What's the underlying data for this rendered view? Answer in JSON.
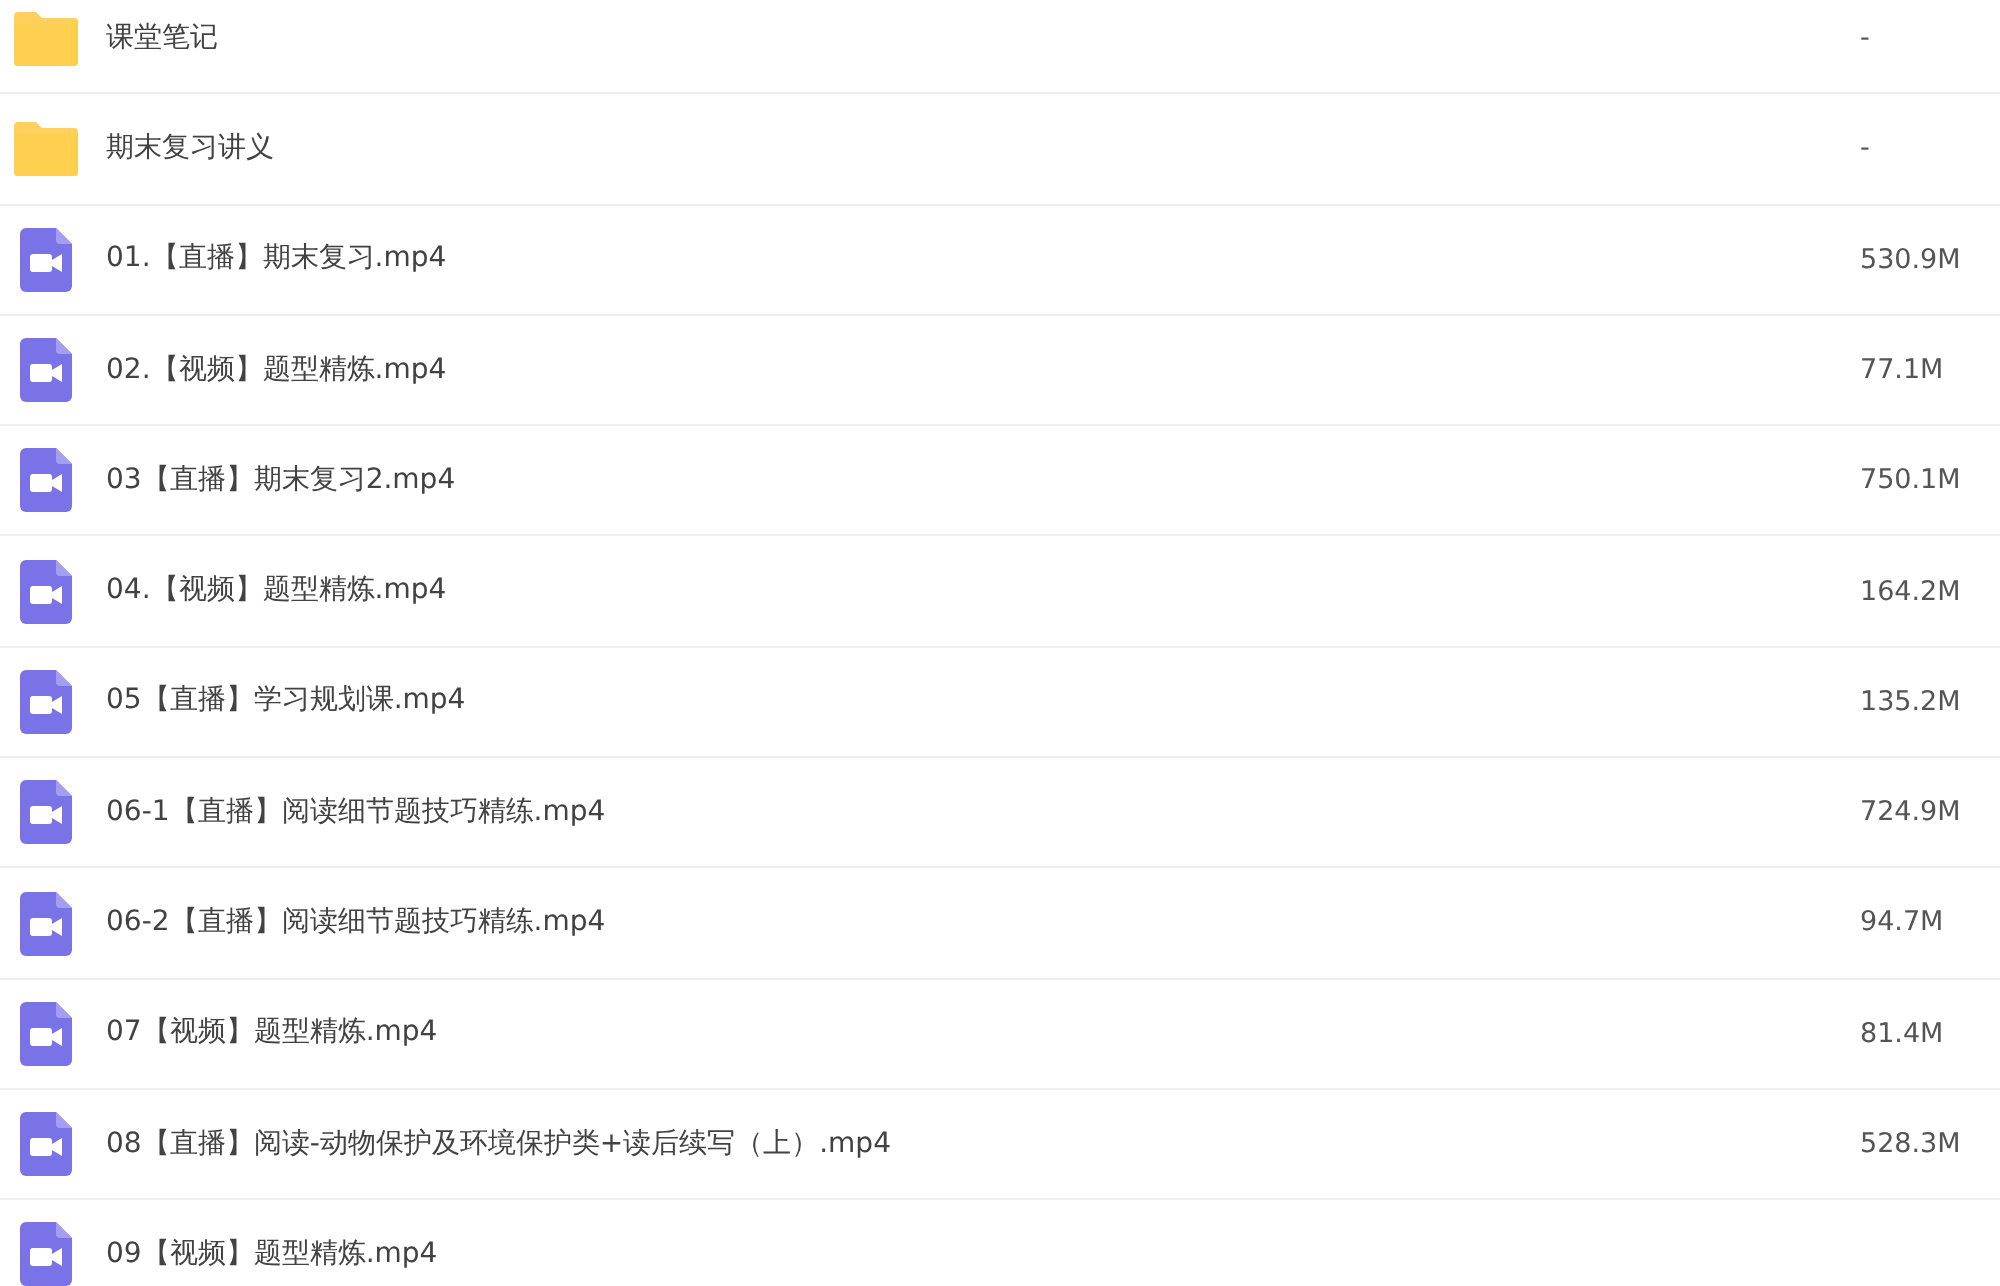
{
  "files": [
    {
      "kind": "folder",
      "name": "课堂笔记",
      "size": "-"
    },
    {
      "kind": "folder",
      "name": "期末复习讲义",
      "size": "-"
    },
    {
      "kind": "video",
      "name": "01.【直播】期末复习.mp4",
      "size": "530.9M"
    },
    {
      "kind": "video",
      "name": "02.【视频】题型精炼.mp4",
      "size": "77.1M"
    },
    {
      "kind": "video",
      "name": "03【直播】期末复习2.mp4",
      "size": "750.1M"
    },
    {
      "kind": "video",
      "name": "04.【视频】题型精炼.mp4",
      "size": "164.2M"
    },
    {
      "kind": "video",
      "name": "05【直播】学习规划课.mp4",
      "size": "135.2M"
    },
    {
      "kind": "video",
      "name": "06-1【直播】阅读细节题技巧精练.mp4",
      "size": "724.9M"
    },
    {
      "kind": "video",
      "name": "06-2【直播】阅读细节题技巧精练.mp4",
      "size": "94.7M"
    },
    {
      "kind": "video",
      "name": "07【视频】题型精炼.mp4",
      "size": "81.4M"
    },
    {
      "kind": "video",
      "name": "08【直播】阅读-动物保护及环境保护类+读后续写（上）.mp4",
      "size": "528.3M"
    },
    {
      "kind": "video",
      "name": "09【视频】题型精炼.mp4"
    }
  ]
}
